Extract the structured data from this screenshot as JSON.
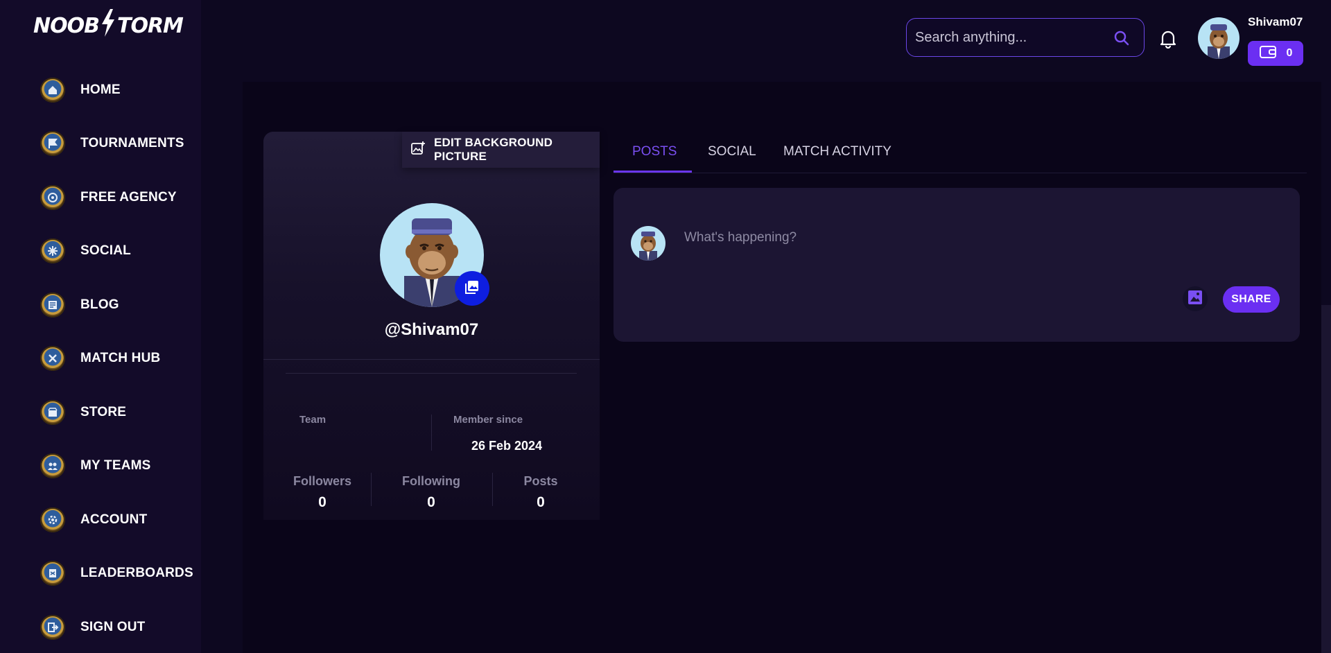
{
  "app": {
    "logo_text": "NOOBSTORM"
  },
  "sidebar": {
    "items": [
      {
        "label": "HOME",
        "icon": "home-icon"
      },
      {
        "label": "TOURNAMENTS",
        "icon": "flag-icon"
      },
      {
        "label": "FREE AGENCY",
        "icon": "agency-icon"
      },
      {
        "label": "SOCIAL",
        "icon": "social-icon"
      },
      {
        "label": "BLOG",
        "icon": "blog-icon"
      },
      {
        "label": "MATCH HUB",
        "icon": "match-hub-icon"
      },
      {
        "label": "STORE",
        "icon": "store-icon"
      },
      {
        "label": "MY TEAMS",
        "icon": "teams-icon"
      },
      {
        "label": "ACCOUNT",
        "icon": "account-icon"
      },
      {
        "label": "LEADERBOARDS",
        "icon": "leaderboard-icon"
      },
      {
        "label": "SIGN OUT",
        "icon": "sign-out-icon"
      }
    ]
  },
  "header": {
    "search_placeholder": "Search anything...",
    "username": "Shivam07",
    "wallet_balance": "0"
  },
  "profile": {
    "edit_background_label": "EDIT BACKGROUND PICTURE",
    "handle": "@Shivam07",
    "team_label": "Team",
    "member_since_label": "Member since",
    "member_since_value": "26 Feb 2024",
    "stats": [
      {
        "label": "Followers",
        "value": "0"
      },
      {
        "label": "Following",
        "value": "0"
      },
      {
        "label": "Posts",
        "value": "0"
      }
    ]
  },
  "tabs": [
    {
      "label": "POSTS",
      "active": true
    },
    {
      "label": "SOCIAL",
      "active": false
    },
    {
      "label": "MATCH ACTIVITY",
      "active": false
    }
  ],
  "composer": {
    "placeholder": "What's happening?",
    "share_label": "SHARE"
  },
  "colors": {
    "accent": "#6b2ff2",
    "background": "#0d0820",
    "sidebar": "#130b29",
    "card": "#1c1533"
  }
}
